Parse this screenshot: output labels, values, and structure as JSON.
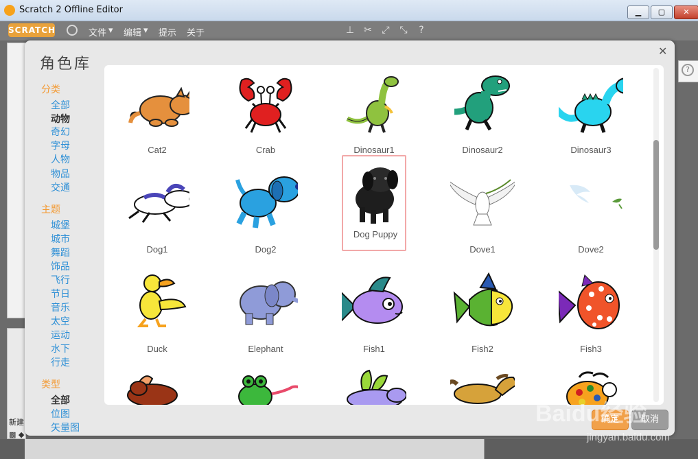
{
  "window": {
    "title": "Scratch 2 Offline Editor"
  },
  "menubar": {
    "logo_text": "SCRATCH",
    "items": [
      "文件",
      "编辑",
      "提示",
      "关于"
    ]
  },
  "background": {
    "new_sprite_label": "新建"
  },
  "dialog": {
    "title": "角色库",
    "category_heading": "分类",
    "categories": [
      "全部",
      "动物",
      "奇幻",
      "字母",
      "人物",
      "物品",
      "交通"
    ],
    "selected_category": "动物",
    "theme_heading": "主题",
    "themes": [
      "城堡",
      "城市",
      "舞蹈",
      "饰品",
      "飞行",
      "节日",
      "音乐",
      "太空",
      "运动",
      "水下",
      "行走"
    ],
    "type_heading": "类型",
    "types": [
      "全部",
      "位图",
      "矢量图"
    ],
    "selected_type": "全部",
    "sprites": [
      {
        "name": "Cat2"
      },
      {
        "name": "Crab"
      },
      {
        "name": "Dinosaur1"
      },
      {
        "name": "Dinosaur2"
      },
      {
        "name": "Dinosaur3"
      },
      {
        "name": "Dog1"
      },
      {
        "name": "Dog2"
      },
      {
        "name": "Dog Puppy"
      },
      {
        "name": "Dove1"
      },
      {
        "name": "Dove2"
      },
      {
        "name": "Duck"
      },
      {
        "name": "Elephant"
      },
      {
        "name": "Fish1"
      },
      {
        "name": "Fish2"
      },
      {
        "name": "Fish3"
      },
      {
        "name": ""
      },
      {
        "name": ""
      },
      {
        "name": ""
      },
      {
        "name": ""
      },
      {
        "name": ""
      }
    ],
    "selected_sprite": "Dog Puppy",
    "ok_label": "确定",
    "cancel_label": "取消"
  },
  "watermark": {
    "brand": "Baidu经验",
    "url": "jingyan.baidu.com"
  },
  "colors": {
    "accent": "#f39a33",
    "link": "#2d8fd6",
    "selection": "#f2a8a8"
  }
}
